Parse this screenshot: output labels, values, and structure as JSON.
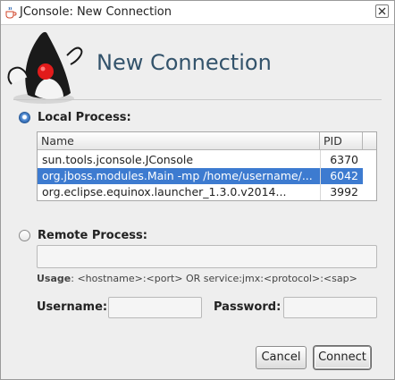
{
  "window": {
    "title": "JConsole: New Connection",
    "icon": "java-coffee-cup-icon",
    "close_icon": "close-icon"
  },
  "header": {
    "title": "New Connection",
    "mascot": "duke-mascot"
  },
  "local_process": {
    "label": "Local Process:",
    "selected": true,
    "columns": [
      "Name",
      "PID"
    ],
    "rows": [
      {
        "name": "sun.tools.jconsole.JConsole",
        "pid": "6370",
        "selected": false
      },
      {
        "name": "org.jboss.modules.Main -mp /home/username/...",
        "pid": "6042",
        "selected": true
      },
      {
        "name": "org.eclipse.equinox.launcher_1.3.0.v2014...",
        "pid": "3992",
        "selected": false
      }
    ]
  },
  "remote_process": {
    "label": "Remote Process:",
    "selected": false,
    "value": "",
    "usage_label": "Usage",
    "usage_text": ": <hostname>:<port> OR service:jmx:<protocol>:<sap>",
    "username_label": "Username:",
    "username_value": "",
    "password_label": "Password:",
    "password_value": ""
  },
  "buttons": {
    "cancel": "Cancel",
    "connect": "Connect"
  },
  "colors": {
    "selection": "#3d7bd0",
    "header_text": "#33536b"
  }
}
